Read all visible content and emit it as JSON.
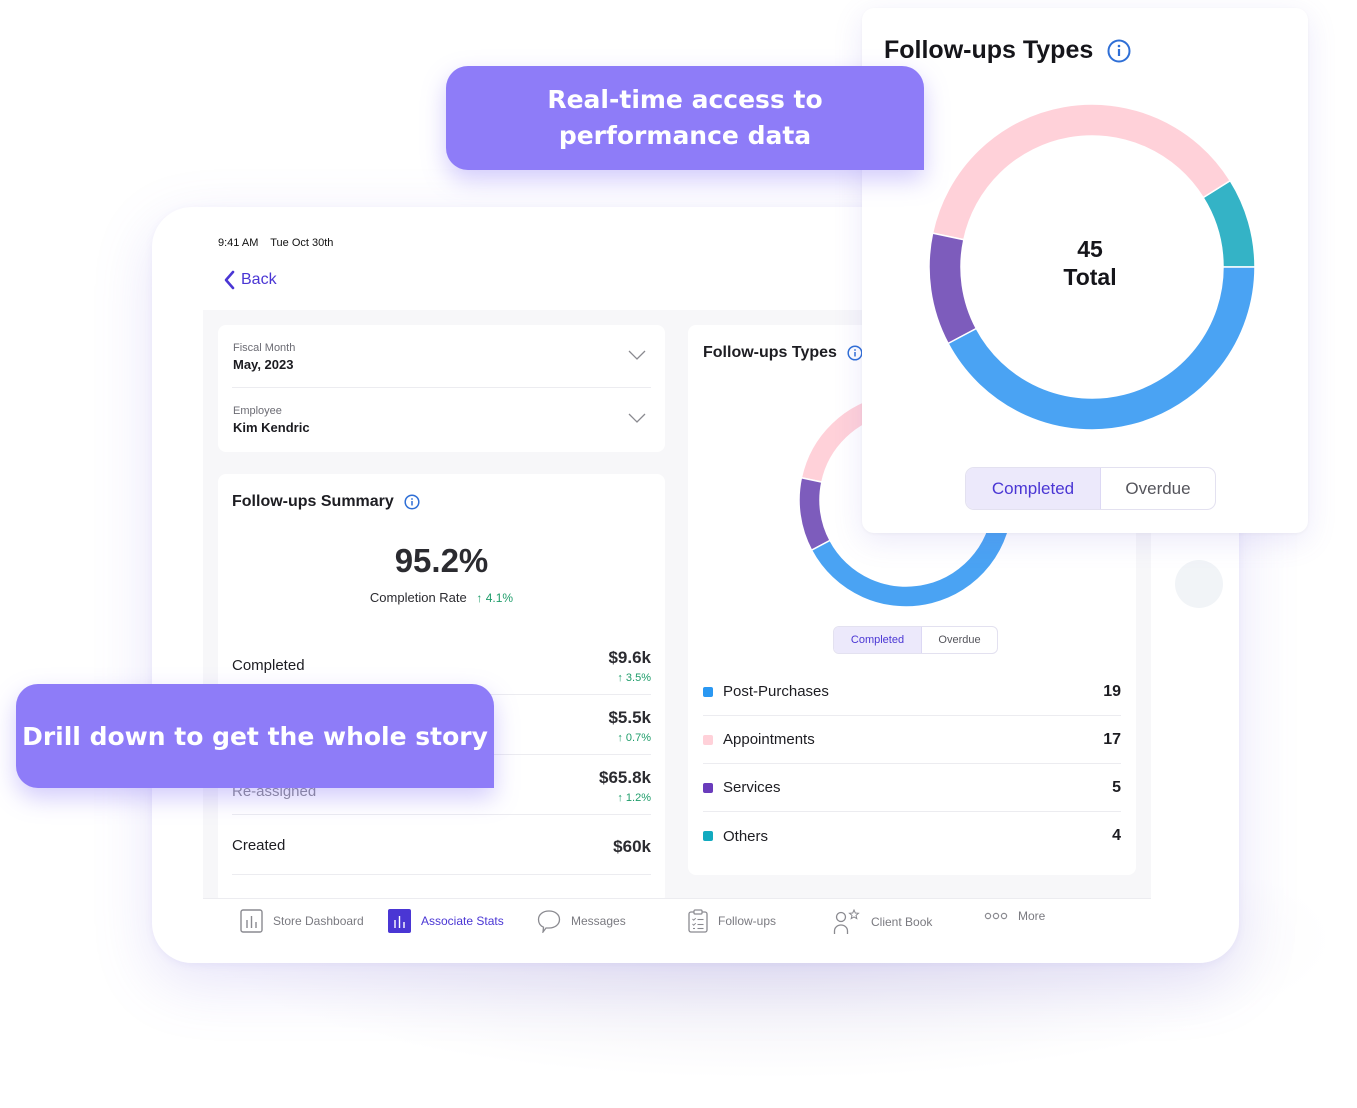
{
  "callouts": {
    "top_line1": "Real-time access to",
    "top_line2": "performance data",
    "left": "Drill down to get the whole story"
  },
  "status_bar": {
    "time": "9:41 AM",
    "date": "Tue Oct 30th"
  },
  "nav": {
    "back_label": "Back"
  },
  "filters": [
    {
      "label": "Fiscal Month",
      "value": "May, 2023"
    },
    {
      "label": "Employee",
      "value": "Kim Kendric"
    }
  ],
  "summary": {
    "title": "Follow-ups Summary",
    "completion_rate": "95.2%",
    "completion_label": "Completion Rate",
    "completion_change": "↑ 4.1%",
    "rows": [
      {
        "label": "Completed",
        "value": "$9.6k",
        "change": "↑ 3.5%"
      },
      {
        "label": "",
        "value": "$5.5k",
        "change": "↑ 0.7%"
      },
      {
        "label": "Re-assigned",
        "value": "$65.8k",
        "change": "↑ 1.2%"
      },
      {
        "label": "Created",
        "value": "$60k",
        "change": ""
      }
    ]
  },
  "types": {
    "title": "Follow-ups Types",
    "toggle": {
      "active": "Completed",
      "inactive": "Overdue"
    },
    "total_value": "45",
    "total_label": "Total"
  },
  "chart_data": {
    "type": "pie",
    "title": "Follow-ups Types",
    "center_label": "45 Total",
    "categories": [
      "Post-Purchases",
      "Appointments",
      "Services",
      "Others"
    ],
    "values": [
      19,
      17,
      5,
      4
    ],
    "colors": [
      "#4aa3f3",
      "#ffd1d9",
      "#7d5cbc",
      "#34b3c6"
    ],
    "legend_colors": [
      "#2a98f2",
      "#ffd1d9",
      "#6a3cbc",
      "#12aabf"
    ],
    "draw_order": [
      "Post-Purchases",
      "Services",
      "Appointments",
      "Others"
    ],
    "start": "3 o'clock, clockwise"
  },
  "bottom_nav": [
    {
      "label": "Store Dashboard",
      "icon": "bar-chart-icon",
      "active": false
    },
    {
      "label": "Associate Stats",
      "icon": "bar-chart-icon",
      "active": true
    },
    {
      "label": "Messages",
      "icon": "speech-bubble-icon",
      "active": false
    },
    {
      "label": "Follow-ups",
      "icon": "clipboard-icon",
      "active": false
    },
    {
      "label": "Client Book",
      "icon": "person-star-icon",
      "active": false
    },
    {
      "label": "More",
      "icon": "more-dots-icon",
      "active": false
    }
  ],
  "colors": {
    "accent": "#4a36d4",
    "callout": "#8e7cf8",
    "positive": "#1e9d6a",
    "info_icon": "#2f6fd6"
  }
}
